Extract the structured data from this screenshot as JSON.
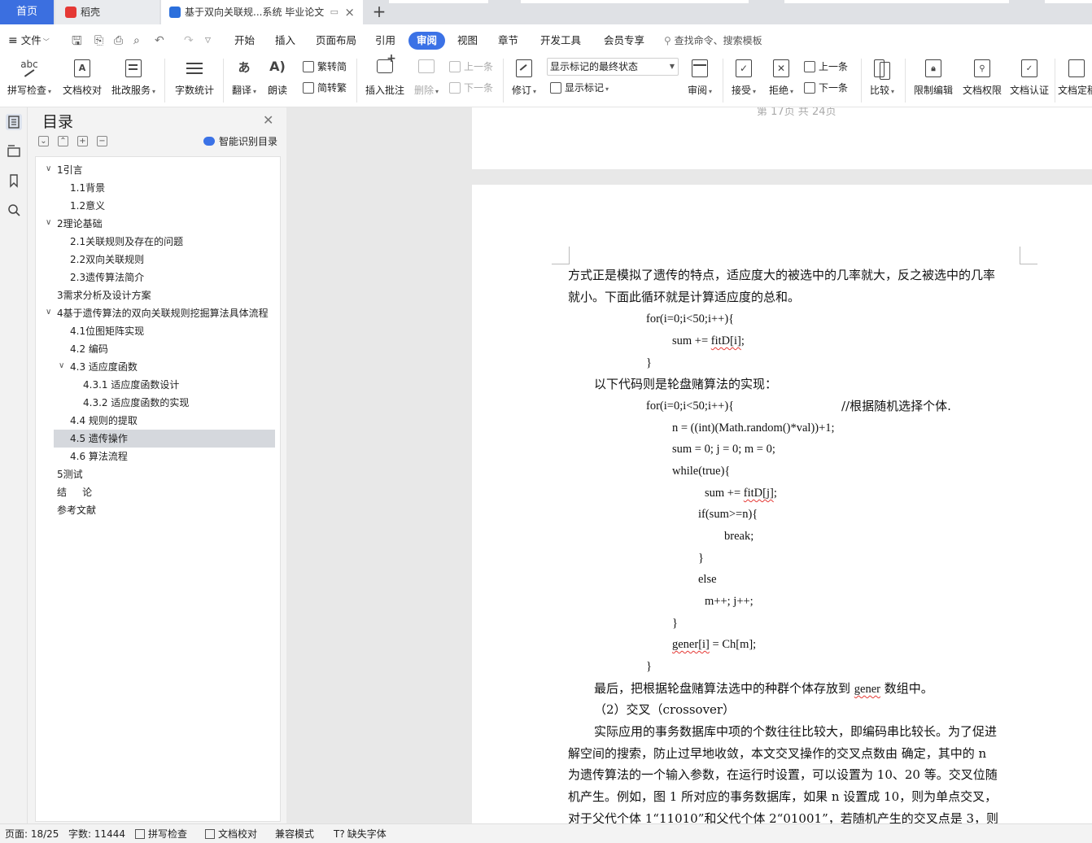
{
  "tabs": {
    "home": "首页",
    "daoke": "稻壳",
    "doc": "基于双向关联规...系统 毕业论文",
    "close": "×",
    "add": "+"
  },
  "menubar": {
    "file": "文件",
    "items": [
      "开始",
      "插入",
      "页面布局",
      "引用",
      "审阅",
      "视图",
      "章节",
      "开发工具",
      "会员专享"
    ],
    "active": "审阅",
    "search": "查找命令、搜索模板"
  },
  "ribbon": {
    "spellcheck": "拼写检查",
    "doccheck": "文档校对",
    "batch": "批改服务",
    "wordcount": "字数统计",
    "translate": "翻译",
    "read": "朗读",
    "trad": "繁转简",
    "simp": "简转繁",
    "insert_comment": "插入批注",
    "delete": "删除",
    "prev1": "上一条",
    "next1": "下一条",
    "track": "修订",
    "markup_state": "显示标记的最终状态",
    "show_markup": "显示标记",
    "review": "审阅",
    "accept": "接受",
    "reject": "拒绝",
    "prev2": "上一条",
    "next2": "下一条",
    "compare": "比较",
    "restrict": "限制编辑",
    "rights": "文档权限",
    "certify": "文档认证",
    "finalize": "文档定稿"
  },
  "outline": {
    "title": "目录",
    "smart": "智能识别目录",
    "items": [
      "1引言",
      "1.1背景",
      "1.2意义",
      "2理论基础",
      "2.1关联规则及存在的问题",
      "2.2双向关联规则",
      "2.3遗传算法简介",
      "3需求分析及设计方案",
      "4基于遗传算法的双向关联规则挖掘算法具体流程",
      "4.1位图矩阵实现",
      "4.2  编码",
      "4.3  适应度函数",
      "4.3.1  适应度函数设计",
      "4.3.2  适应度函数的实现",
      "4.4  规则的提取",
      "4.5  遗传操作",
      "4.6  算法流程",
      "5测试",
      "结     论",
      "参考文献"
    ],
    "selected": "4.5  遗传操作"
  },
  "document": {
    "page_footer": "第 17页 共 24页",
    "lines": [
      "方式正是模拟了遗传的特点，适应度大的被选中的几率就大，反之被选中的几率",
      "就小。下面此循环就是计算适应度的总和。",
      "for(i=0;i<50;i++){",
      "sum += ",
      "fitD[i]",
      ";",
      "}",
      "以下代码则是轮盘赌算法的实现：",
      "for(i=0;i<50;i++){",
      "//根据随机选择个体.",
      "n = ((int)(Math.random()*val))+1;",
      "sum = 0; j = 0; m = 0;",
      "while(true){",
      "sum += ",
      "fitD[j]",
      ";",
      "if(sum>=n){",
      "break;",
      "}",
      "else",
      "m++; j++;",
      "}",
      "gener[i]",
      " = Ch[m];",
      "}",
      "最后，把根据轮盘赌算法选中的种群个体存放到 ",
      "gener",
      " 数组中。",
      "（2）交叉（crossover）",
      "实际应用的事务数据库中项的个数往往比较大，即编码串比较长。为了促进",
      "解空间的搜索，防止过早地收敛，本文交叉操作的交叉点数由  确定，其中的 n",
      "为遗传算法的一个输入参数，在运行时设置，可以设置为 10、20 等。交叉位随",
      "机产生。例如，图 1 所对应的事务数据库，如果 n 设置成 10，则为单点交叉，",
      "对于父代个体 1“11010”和父代个体 2“01001”，若随机产生的交叉点是 3，则"
    ]
  },
  "status": {
    "page": "页面: 18/25",
    "words": "字数: 11444",
    "spell": "拼写检查",
    "proof": "文档校对",
    "compat": "兼容模式",
    "missing_font": "缺失字体"
  },
  "colors": {
    "accent": "#3b72e6",
    "home_tab": "#3b6fe0",
    "spell_underline": "#e53935"
  }
}
